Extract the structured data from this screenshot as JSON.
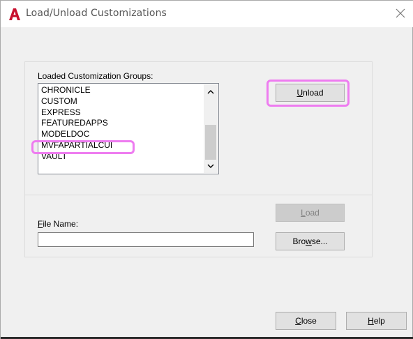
{
  "window": {
    "title": "Load/Unload Customizations",
    "app_icon": "autocad-a-icon",
    "close_icon": "close-icon"
  },
  "groups": {
    "label_prefix": "Loaded Customization Groups:",
    "items": [
      "CHRONICLE",
      "CUSTOM",
      "EXPRESS",
      "FEATUREDAPPS",
      "MODELDOC",
      "MVFAPARTIALCUI",
      "VAULT"
    ],
    "highlighted_item": "MVFAPARTIALCUI"
  },
  "buttons": {
    "unload": {
      "mnemonic": "U",
      "rest": "nload"
    },
    "load": {
      "mnemonic": "L",
      "rest": "oad",
      "enabled": false
    },
    "browse": {
      "pre": "Bro",
      "mnemonic": "w",
      "rest": "se..."
    },
    "close": {
      "mnemonic": "C",
      "rest": "lose"
    },
    "help": {
      "mnemonic": "H",
      "rest": "elp"
    }
  },
  "file": {
    "label_mnemonic": "F",
    "label_rest": "ile Name:",
    "value": ""
  },
  "colors": {
    "highlight": "#ee7cf0",
    "app_icon_red": "#c8102e",
    "dialog_bg": "#f0f0f0"
  }
}
